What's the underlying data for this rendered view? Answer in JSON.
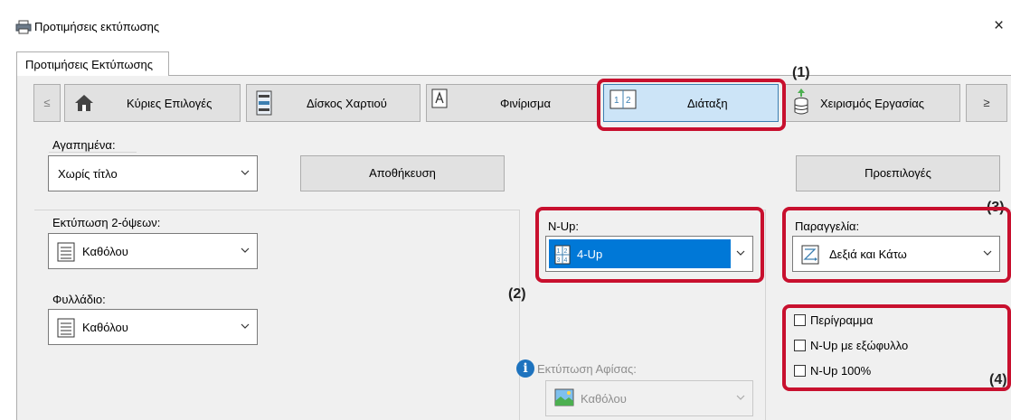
{
  "window": {
    "title": "Προτιμήσεις εκτύπωσης",
    "close_glyph": "×"
  },
  "tab": {
    "label": "Προτιμήσεις Εκτύπωσης"
  },
  "nav": {
    "prev": "≤",
    "next": "≥",
    "items": [
      {
        "label": "Κύριες Επιλογές",
        "icon": "house-icon"
      },
      {
        "label": "Δίσκος Χαρτιού",
        "icon": "paper-tray-icon"
      },
      {
        "label": "Φινίρισμα",
        "icon": "finishing-icon"
      },
      {
        "label": "Διάταξη",
        "icon": "layout-icon",
        "active": true,
        "icon_text": "1|2"
      },
      {
        "label": "Χειρισμός Εργασίας",
        "icon": "job-handling-icon"
      }
    ]
  },
  "favorites": {
    "label": "Αγαπημένα:",
    "value": "Χωρίς τίτλο",
    "save_label": "Αποθήκευση",
    "defaults_label": "Προεπιλογές"
  },
  "duplex": {
    "label": "Εκτύπωση 2-όψεων:",
    "value": "Καθόλου"
  },
  "booklet": {
    "label": "Φυλλάδιο:",
    "value": "Καθόλου"
  },
  "nup": {
    "label": "N-Up:",
    "value": "4-Up",
    "icon_text_top": "1 2",
    "icon_text_bottom": "3 4"
  },
  "order": {
    "label": "Παραγγελία:",
    "value": "Δεξιά και Κάτω"
  },
  "checkboxes": [
    {
      "label": "Περίγραμμα",
      "checked": false
    },
    {
      "label": "N-Up με εξώφυλλο",
      "checked": false
    },
    {
      "label": "N-Up 100%",
      "checked": false
    }
  ],
  "poster": {
    "label": "Εκτύπωση Αφίσας:",
    "value": "Καθόλου",
    "info_glyph": "i"
  },
  "callouts": {
    "c1": "(1)",
    "c2": "(2)",
    "c3": "(3)",
    "c4": "(4)"
  },
  "colors": {
    "highlight": "#c8102e",
    "active_tab": "#cce4f7",
    "selected": "#0078d7"
  }
}
